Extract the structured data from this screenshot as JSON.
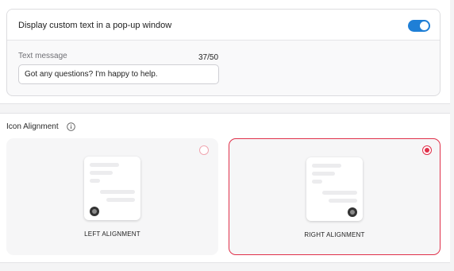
{
  "popup": {
    "title": "Display custom text in a pop-up window",
    "toggle_on": true,
    "field_label": "Text message",
    "char_count": "37/50",
    "message_value": "Got any questions? I'm happy to help."
  },
  "alignment": {
    "section_title": "Icon Alignment",
    "options": [
      {
        "label": "LEFT ALIGNMENT",
        "selected": false
      },
      {
        "label": "RIGHT ALIGNMENT",
        "selected": true
      }
    ]
  },
  "colors": {
    "toggle": "#1f7fd6",
    "selected_border": "#e0304a"
  }
}
